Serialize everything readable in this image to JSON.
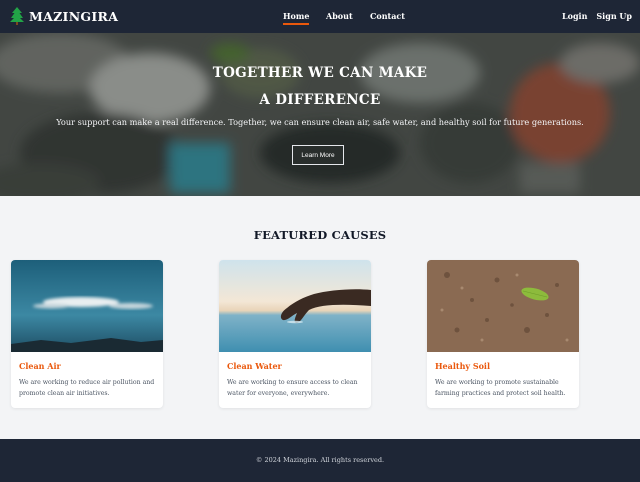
{
  "nav": {
    "brand": "MAZINGIRA",
    "links": {
      "home": "Home",
      "about": "About",
      "contact": "Contact"
    },
    "auth": {
      "login": "Login",
      "signup": "Sign Up"
    },
    "accent_color": "#ea580c",
    "bg_color": "#1e2636"
  },
  "hero": {
    "title_line1": "TOGETHER WE CAN MAKE",
    "title_line2": "A DIFFERENCE",
    "subtitle": "Your support can make a real difference. Together, we can ensure clean air, safe water, and healthy soil for future generations.",
    "cta_label": "Learn More"
  },
  "featured": {
    "heading": "FEATURED CAUSES",
    "cards": [
      {
        "title": "Clean Air",
        "description": "We are working to reduce air pollution and promote clean air initiatives."
      },
      {
        "title": "Clean Water",
        "description": "We are working to ensure access to clean water for everyone, everywhere."
      },
      {
        "title": "Healthy Soil",
        "description": "We are working to promote sustainable farming practices and protect soil health."
      }
    ]
  },
  "footer": {
    "copyright": "© 2024 Mazingira. All rights reserved."
  }
}
